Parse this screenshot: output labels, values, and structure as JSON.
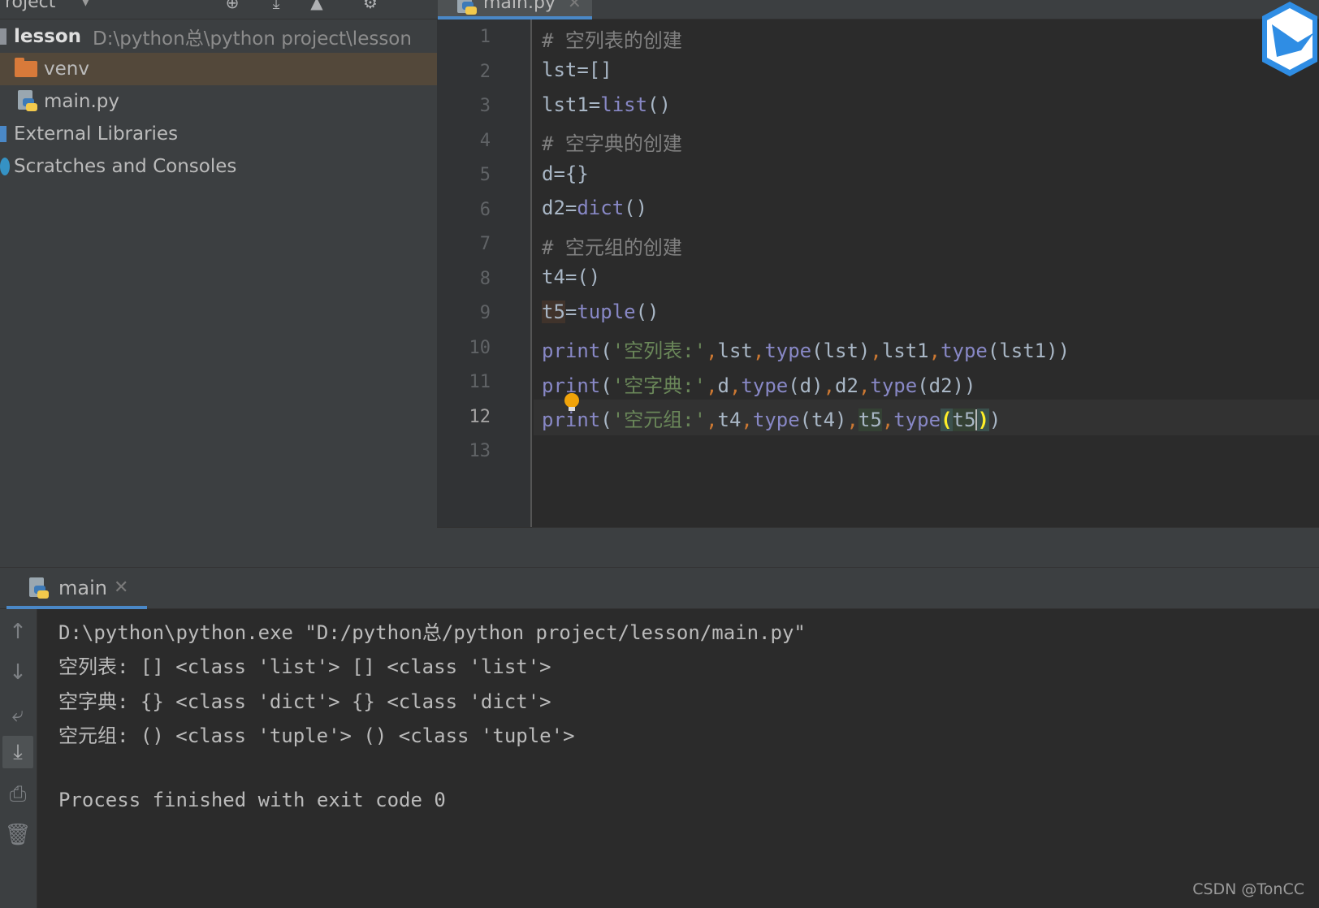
{
  "sidebar": {
    "title": "roject",
    "tree": [
      {
        "label": "lesson",
        "path": "D:\\python总\\python project\\lesson"
      },
      {
        "label": "venv"
      },
      {
        "label": "main.py"
      },
      {
        "label": "External Libraries"
      },
      {
        "label": "Scratches and Consoles"
      }
    ]
  },
  "editor": {
    "tab_label": "main.py",
    "current_line": 12,
    "line_numbers": [
      "1",
      "2",
      "3",
      "4",
      "5",
      "6",
      "7",
      "8",
      "9",
      "10",
      "11",
      "12",
      "13"
    ]
  },
  "code": {
    "l1": "# 空列表的创建",
    "l2": "lst=[]",
    "l3_a": "lst1=",
    "l3_b": "list",
    "l3_c": "()",
    "l4": "# 空字典的创建",
    "l5": "d={}",
    "l6_a": "d2=",
    "l6_b": "dict",
    "l6_c": "()",
    "l7": "# 空元组的创建",
    "l8": "t4=()",
    "l9_a": "t5",
    "l9_b": "=",
    "l9_c": "tuple",
    "l9_d": "()",
    "l10": {
      "f": "print",
      "p1": "(",
      "s": "'空列表:'",
      "c": ",",
      "a1": "lst",
      "t1": "type",
      "a2": "(lst)",
      "a3": "lst1",
      "t2": "type",
      "a4": "(lst1))"
    },
    "l11": {
      "f": "print",
      "p1": "(",
      "s": "'空字典:'",
      "c": ",",
      "a1": "d",
      "t1": "type",
      "a2": "(d)",
      "a3": "d2",
      "t2": "type",
      "a4": "(d2))"
    },
    "l12": {
      "f": "print",
      "p1": "(",
      "s": "'空元组:'",
      "c": ",",
      "a1": "t4",
      "t1": "type",
      "a2": "(t4)",
      "a3": "t5",
      "t2": "type",
      "po": "(",
      "a4": "t5",
      "pc": ")",
      "pe": ")"
    }
  },
  "run": {
    "tab_label": "main",
    "output": [
      "D:\\python\\python.exe \"D:/python总/python project/lesson/main.py\"",
      "空列表: [] <class 'list'> [] <class 'list'>",
      "空字典: {} <class 'dict'> {} <class 'dict'>",
      "空元组: () <class 'tuple'> () <class 'tuple'>",
      "",
      "Process finished with exit code 0"
    ]
  },
  "watermark": "CSDN @TonCC",
  "colors": {
    "background": "#2b2b2b",
    "panel": "#3c3f41",
    "accent": "#4a88c7",
    "keyword_builtin": "#8888c6",
    "string": "#6a8759",
    "comment": "#808080",
    "comma": "#cc7832"
  },
  "icons": [
    "circle-plus-icon",
    "download-icon",
    "up-icon",
    "gear-icon",
    "folder-icon",
    "python-file-icon",
    "bulb-icon",
    "close-icon",
    "arrow-up-icon",
    "arrow-down-icon",
    "soft-wrap-icon",
    "scroll-to-end-icon",
    "print-icon",
    "trash-icon",
    "bird-logo-icon"
  ]
}
